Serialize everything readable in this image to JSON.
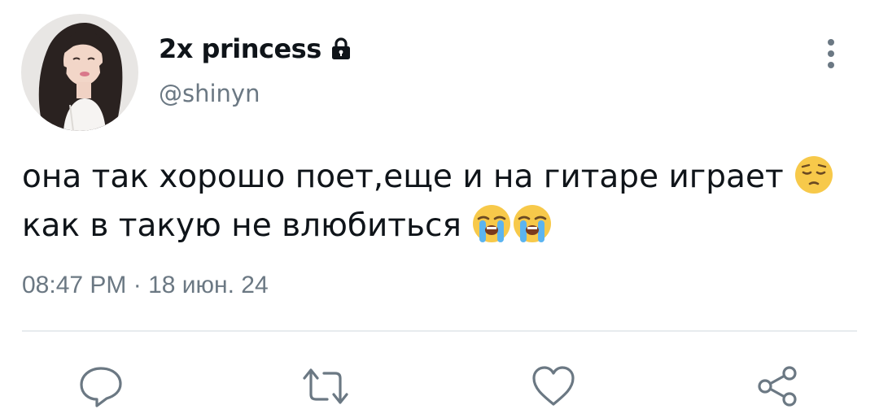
{
  "user": {
    "display_name": "2x princess",
    "handle": "@shinyn",
    "protected": true,
    "avatar_description": "avatar-photo"
  },
  "tweet": {
    "text_part1": "она так хорошо поет,еще и на гитаре играет ",
    "emoji_pensive": "pensive-face-emoji",
    "text_part2": " как в такую не влюбиться ",
    "emoji_crying": "loudly-crying-face-emoji"
  },
  "meta": {
    "timestamp": "08:47 PM · 18 июн. 24"
  },
  "actions": {
    "reply_icon": "reply-icon",
    "retweet_icon": "retweet-icon",
    "like_icon": "heart-icon",
    "share_icon": "share-icon"
  },
  "colors": {
    "text": "#0f1419",
    "secondary": "#6b7883",
    "divider": "#e7ebee",
    "background": "#ffffff"
  }
}
